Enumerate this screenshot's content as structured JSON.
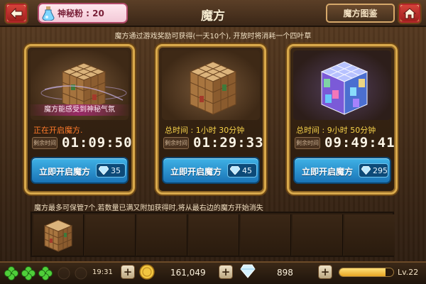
{
  "header": {
    "powder_label": "神秘粉 : 20",
    "title": "魔方",
    "atlas_label": "魔方图鉴"
  },
  "notice": "魔方通过游戏奖励可获得(一天10个), 开放时将消耗一个四叶草",
  "cards": [
    {
      "banner": "魔方能感受到神秘气氛",
      "status": "正在开启魔方.",
      "remain_label": "剩余时间",
      "timer": "01:09:50",
      "button_label": "立即开启魔方",
      "cost": "35"
    },
    {
      "status": "总时间 : 1小时 30分钟",
      "remain_label": "剩余时间",
      "timer": "01:29:33",
      "button_label": "立即开启魔方",
      "cost": "45"
    },
    {
      "status": "总时间 : 9小时 50分钟",
      "remain_label": "剩余时间",
      "timer": "09:49:41",
      "button_label": "立即开启魔方",
      "cost": "295"
    }
  ],
  "storage_text": "魔方最多可保管7个,若数量已满又附加获得时,将从最右边的魔方开始消失",
  "bottom": {
    "clovers_filled": 3,
    "clovers_total": 5,
    "energy_time": "19:31",
    "coins": "161,049",
    "diamonds": "898",
    "xp_fraction": 0.85,
    "level": "Lv.22"
  },
  "colors": {
    "frame_gold": "#d9a94b",
    "button_blue": "#1a74b6",
    "timer_orange": "#ff7a2a",
    "total_yellow": "#f7d24a"
  },
  "icons": [
    "back-arrow-icon",
    "potion-icon",
    "home-icon",
    "diamond-icon",
    "clover-icon",
    "coin-icon",
    "plus-icon"
  ]
}
